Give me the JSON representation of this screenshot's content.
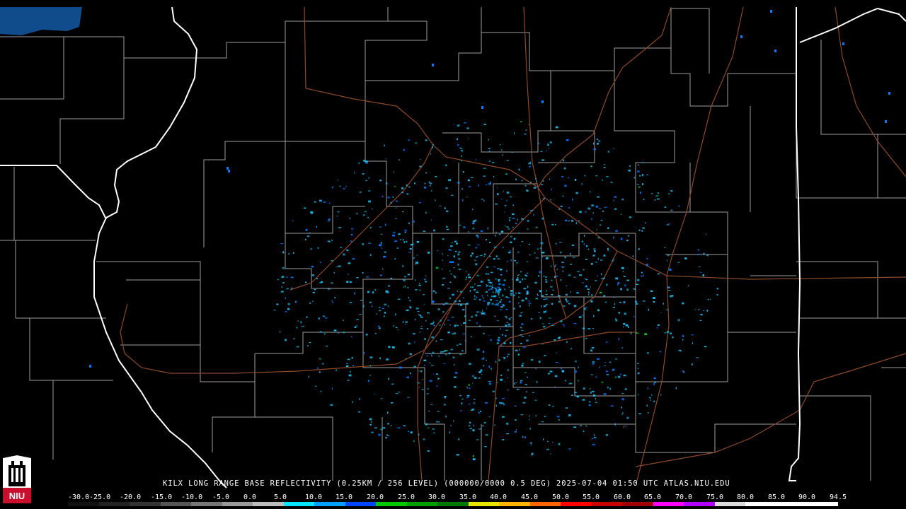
{
  "product": {
    "caption": "KILX LONG RANGE BASE REFLECTIVITY (0.25KM / 256 LEVEL) (000000/0000 0.5 DEG) 2025-07-04 01:50 UTC  ATLAS.NIU.EDU",
    "station": "KILX",
    "elevation_deg": 0.5,
    "timestamp_utc": "2025-07-04 01:50 UTC",
    "source": "ATLAS.NIU.EDU"
  },
  "logo": {
    "text": "NIU",
    "icon": "niu-tower-logo",
    "brand_color": "#c8102e"
  },
  "legend": {
    "labels": [
      "-30.0",
      "-25.0",
      "-20.0",
      "-15.0",
      "-10.0",
      "-5.0",
      "0.0",
      "5.0",
      "10.0",
      "15.0",
      "20.0",
      "25.0",
      "30.0",
      "35.0",
      "40.0",
      "45.0",
      "50.0",
      "55.0",
      "60.0",
      "65.0",
      "70.0",
      "75.0",
      "80.0",
      "85.0",
      "90.0",
      "94.5"
    ],
    "colors": [
      "#111111",
      "#222222",
      "#333333",
      "#555555",
      "#777777",
      "#999999",
      "#bbbbbb",
      "#00e6ff",
      "#00a0ff",
      "#0046ff",
      "#00c800",
      "#00a000",
      "#007800",
      "#e6e600",
      "#ffb400",
      "#ff6400",
      "#ff0000",
      "#c80000",
      "#a00000",
      "#ff00ff",
      "#b400ff",
      "#dcdcdc",
      "#ffffff",
      "#ffffff",
      "#ffffff"
    ]
  },
  "map_colors": {
    "background": "#000000",
    "county_lines": "#b8b8b8",
    "state_lines": "#ffffff",
    "highways": "#8b4a2a",
    "echo_primary": "#1fb8e8",
    "echo_secondary": "#0a78ff",
    "echo_strong": "#10c030"
  }
}
